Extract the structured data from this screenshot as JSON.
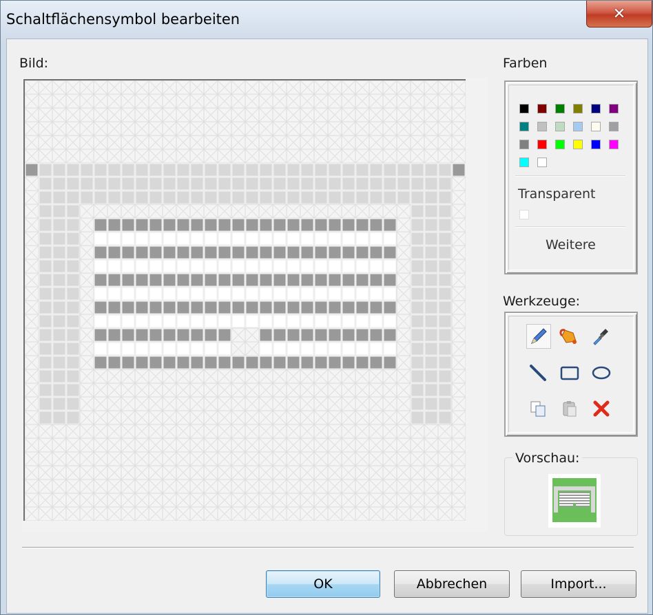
{
  "window": {
    "title": "Schaltflächensymbol bearbeiten"
  },
  "labels": {
    "bild": "Bild:",
    "farben": "Farben",
    "werkzeuge": "Werkzeuge:",
    "vorschau": "Vorschau:"
  },
  "colors": {
    "palette": [
      "#000000",
      "#800000",
      "#008000",
      "#808000",
      "#000080",
      "#800080",
      "#008080",
      "#c0c0c0",
      "#c0dcc0",
      "#a6caf0",
      "#fffbf0",
      "#a0a0a4",
      "#808080",
      "#ff0000",
      "#00ff00",
      "#ffff00",
      "#0000ff",
      "#ff00ff",
      "#00ffff",
      "#ffffff"
    ],
    "transparent_label": "Transparent",
    "more_label": "Weitere"
  },
  "tools": [
    {
      "name": "pencil-icon"
    },
    {
      "name": "fill-icon"
    },
    {
      "name": "pick-color-icon"
    },
    {
      "name": "line-icon"
    },
    {
      "name": "rectangle-icon"
    },
    {
      "name": "ellipse-icon"
    },
    {
      "name": "copy-icon"
    },
    {
      "name": "paste-icon"
    },
    {
      "name": "clear-icon"
    }
  ],
  "buttons": {
    "ok": "OK",
    "cancel": "Abbrechen",
    "import": "Import..."
  },
  "pixel_image": {
    "size": 32,
    "palette": {
      "T": "transparent",
      "L": "#d8d8d8",
      "G": "#999999",
      "W": "#ffffff"
    },
    "rows": [
      "TTTTTTTTTTTTTTTTTTTTTTTTTTTTTTTT",
      "TTTTTTTTTTTTTTTTTTTTTTTTTTTTTTTT",
      "TTTTTTTTTTTTTTTTTTTTTTTTTTTTTTTT",
      "TTTTTTTTTTTTTTTTTTTTTTTTTTTTTTTT",
      "TTTTTTTTTTTTTTTTTTTTTTTTTTTTTTTT",
      "TTTTTTTTTTTTTTTTTTTTTTTTTTTTTTTT",
      "GLLLLLLLLLLLLLLLLLLLLLLLLLLLLLLG",
      "TLLLLLLLLLLLLLLLLLLLLLLLLLLLLLLT",
      "TLLLLLLLLLLLLLLLLLLLLLLLLLLLLLLT",
      "TLLLTTTTTTTTTTTTTTTTTTTTTTTTLLLT",
      "TLLLTGGGGGGGGGGGGGGGGGGGGGGTLLLT",
      "TLLLTWWWWWWWWWWWWWWWWWWWWWWTLLLT",
      "TLLLTGGGGGGGGGGGGGGGGGGGGGGTLLLT",
      "TLLLTWWWWWWWWWWWWWWWWWWWWWWTLLLT",
      "TLLLTGGGGGGGGGGGGGGGGGGGGGGTLLLT",
      "TLLLTWWWWWWWWWWWWWWWWWWWWWWTLLLT",
      "TLLLTGGGGGGGGGGGGGGGGGGGGGGTLLLT",
      "TLLLTWWWWWWWWWWWWWWWWWWWWWWTLLLT",
      "TLLLTGGGGGGGGGGTTGGGGGGGGGGTLLLT",
      "TLLLTWWWWWWWWWWTTWWWWWWWWWWTLLLT",
      "TLLLTGGGGGGGGGGGGGGGGGGGGGGTLLLT",
      "TLLLTTTTTTTTTTTTTTTTTTTTTTTTLLLT",
      "TLLLTTTTTTTTTTTTTTTTTTTTTTTTLLLT",
      "TLLLTTTTTTTTTTTTTTTTTTTTTTTTLLLT",
      "TLLLTTTTTTTTTTTTTTTTTTTTTTTTLLLT",
      "TTTTTTTTTTTTTTTTTTTTTTTTTTTTTTTT",
      "TTTTTTTTTTTTTTTTTTTTTTTTTTTTTTTT",
      "TTTTTTTTTTTTTTTTTTTTTTTTTTTTTTTT",
      "TTTTTTTTTTTTTTTTTTTTTTTTTTTTTTTT",
      "TTTTTTTTTTTTTTTTTTTTTTTTTTTTTTTT",
      "TTTTTTTTTTTTTTTTTTTTTTTTTTTTTTTT",
      "TTTTTTTTTTTTTTTTTTTTTTTTTTTTTTTT"
    ]
  },
  "preview": {
    "accent": "#6abf5a"
  }
}
